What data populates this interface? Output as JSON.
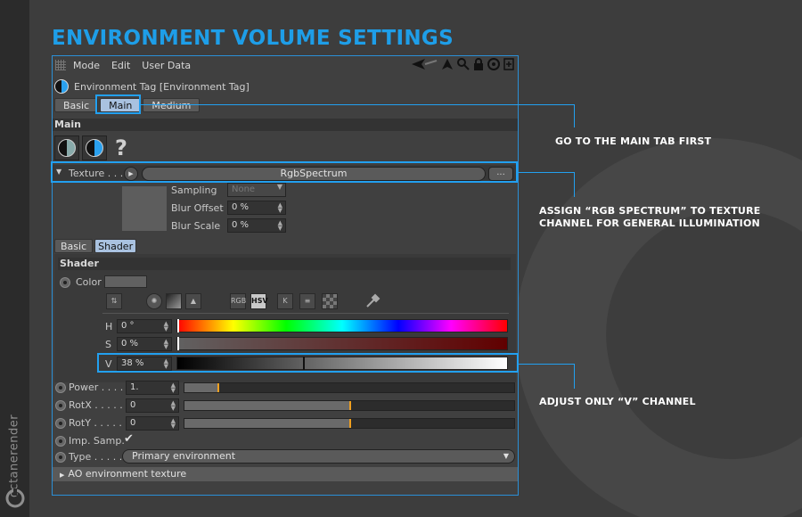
{
  "page_title": "ENVIRONMENT VOLUME SETTINGS",
  "brand": {
    "name": "octanerender"
  },
  "menubar": {
    "items": [
      "Mode",
      "Edit",
      "User Data"
    ]
  },
  "tag": {
    "title": "Environment Tag [Environment Tag]"
  },
  "tabs": [
    {
      "label": "Basic",
      "active": false
    },
    {
      "label": "Main",
      "active": true
    },
    {
      "label": "Medium",
      "active": false
    }
  ],
  "main_section": {
    "title": "Main"
  },
  "texture": {
    "label": "Texture . . .",
    "value": "RgbSpectrum",
    "more_button": "...",
    "sampling": {
      "label": "Sampling",
      "value": "None"
    },
    "blur_offset": {
      "label": "Blur Offset",
      "value": "0 %"
    },
    "blur_scale": {
      "label": "Blur Scale",
      "value": "0 %"
    }
  },
  "shader_tabs": [
    {
      "label": "Basic",
      "active": false
    },
    {
      "label": "Shader",
      "active": true
    }
  ],
  "shader_section": {
    "title": "Shader"
  },
  "color": {
    "label": "Color"
  },
  "color_modes": [
    "RGB",
    "HSV",
    "K"
  ],
  "hsv": {
    "h": {
      "label": "H",
      "value": "0 °",
      "fraction": 0.0
    },
    "s": {
      "label": "S",
      "value": "0 %",
      "fraction": 0.0
    },
    "v": {
      "label": "V",
      "value": "38 %",
      "fraction": 0.38
    }
  },
  "params": [
    {
      "label": "Power . . . .",
      "value": "1.",
      "fraction": 0.1
    },
    {
      "label": "RotX . . . . .",
      "value": "0",
      "fraction": 0.5
    },
    {
      "label": "RotY . . . . .",
      "value": "0",
      "fraction": 0.5
    }
  ],
  "imp_samp": {
    "label": "Imp. Samp.",
    "checked": true
  },
  "type": {
    "label": "Type . . . . .",
    "value": "Primary environment"
  },
  "ao": {
    "label": "AO environment texture"
  },
  "callouts": {
    "main_tab": "GO TO THE MAIN TAB FIRST",
    "rgb_line1": "ASSIGN “RGB SPECTRUM” TO TEXTURE",
    "rgb_line2": "CHANNEL FOR GENERAL ILLUMINATION",
    "v_channel": "ADJUST ONLY “V” CHANNEL"
  },
  "colors": {
    "accent": "#22a0f0",
    "title": "#1e9ee8",
    "slider_knob": "#f0a020"
  }
}
